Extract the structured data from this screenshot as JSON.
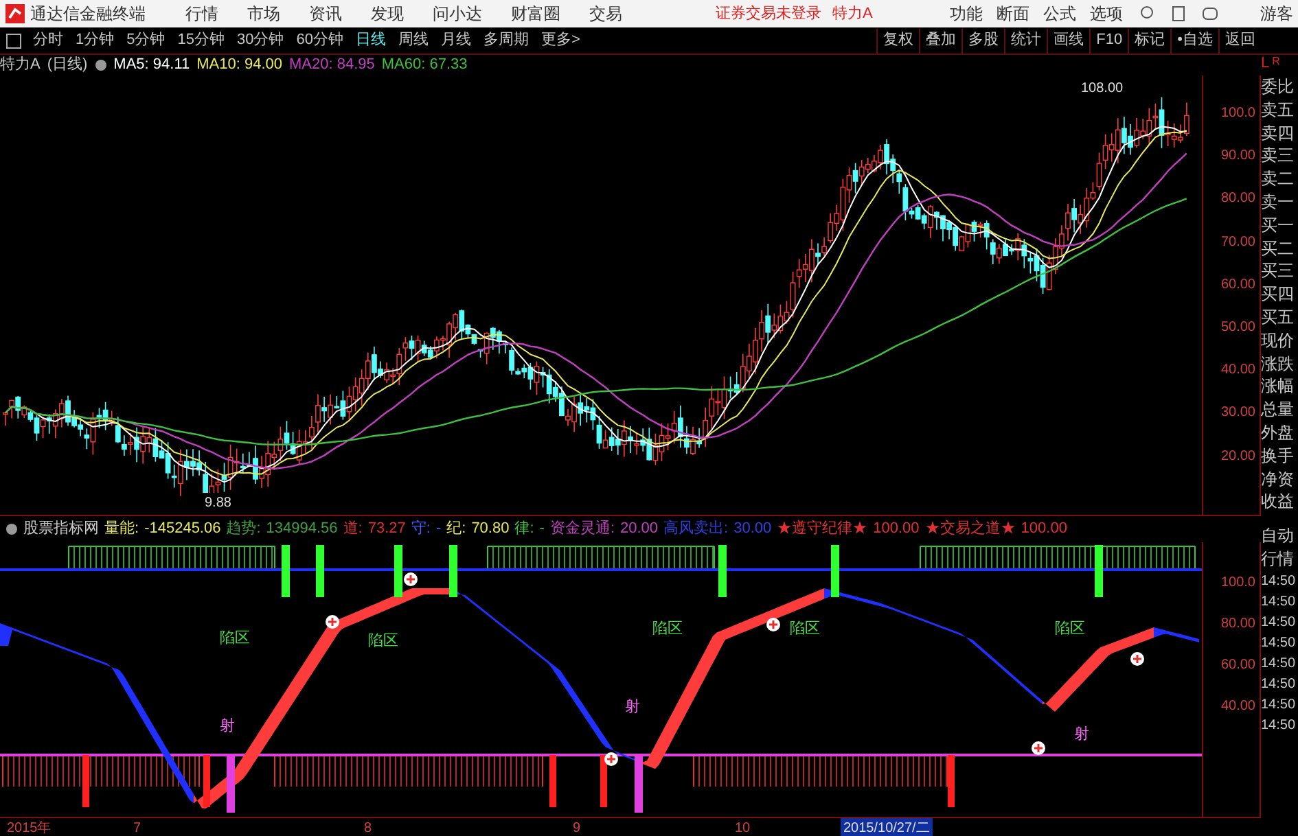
{
  "title_bar": {
    "app_name": "通达信金融终端",
    "menu": [
      "行情",
      "市场",
      "资讯",
      "发现",
      "问小达",
      "财富圈",
      "交易"
    ],
    "login_status": "证券交易未登录",
    "stock_name": "特力A",
    "actions": [
      "功能",
      "断面",
      "公式",
      "选项"
    ],
    "user": "游客"
  },
  "toolbar": {
    "periods": [
      {
        "label": "分时",
        "selected": false
      },
      {
        "label": "1分钟",
        "selected": false
      },
      {
        "label": "5分钟",
        "selected": false
      },
      {
        "label": "15分钟",
        "selected": false
      },
      {
        "label": "30分钟",
        "selected": false
      },
      {
        "label": "60分钟",
        "selected": false
      },
      {
        "label": "日线",
        "selected": true
      },
      {
        "label": "周线",
        "selected": false
      },
      {
        "label": "月线",
        "selected": false
      },
      {
        "label": "多周期",
        "selected": false
      },
      {
        "label": "更多>",
        "selected": false
      }
    ],
    "buttons": [
      "复权",
      "叠加",
      "多股",
      "统计",
      "画线",
      "F10",
      "标记",
      "•自选",
      "返回"
    ]
  },
  "price_chart": {
    "title": "特力A",
    "period": "(日线)",
    "ma": [
      {
        "label": "MA5: 94.11",
        "color": "#ffffff"
      },
      {
        "label": "MA10: 94.00",
        "color": "#e8e85a"
      },
      {
        "label": "MA20: 84.95",
        "color": "#c040c0"
      },
      {
        "label": "MA60: 67.33",
        "color": "#40c040"
      }
    ],
    "high_label": "108.00",
    "low_label": "9.88",
    "yticks": [
      "100.0",
      "90.00",
      "80.00",
      "70.00",
      "60.00",
      "50.00",
      "40.00",
      "30.00",
      "20.00"
    ]
  },
  "indicator": {
    "name": "股票指标网",
    "items": [
      {
        "label": "量能:",
        "value": "-145245.06",
        "color": "#e8e85a"
      },
      {
        "label": "趋势:",
        "value": "134994.56",
        "color": "#40a040"
      },
      {
        "label": "道:",
        "value": "73.27",
        "color": "#e03030"
      },
      {
        "label": "守:",
        "value": "-",
        "color": "#4060ff"
      },
      {
        "label": "纪:",
        "value": "70.80",
        "color": "#e8e85a"
      },
      {
        "label": "律:",
        "value": "-",
        "color": "#40c040"
      },
      {
        "label": "资金灵通:",
        "value": "20.00",
        "color": "#c040c0"
      },
      {
        "label": "高风卖出:",
        "value": "30.00",
        "color": "#3040e0"
      },
      {
        "label": "★遵守纪律★",
        "value": "100.00",
        "color": "#e03030"
      },
      {
        "label": "★交易之道★",
        "value": "100.00",
        "color": "#e03030"
      }
    ],
    "yticks": [
      "100.0",
      "80.00",
      "60.00",
      "40.00"
    ],
    "zone_labels": [
      {
        "text": "陷区",
        "kind": "zone"
      },
      {
        "text": "陷区",
        "kind": "zone"
      },
      {
        "text": "陷区",
        "kind": "zone"
      },
      {
        "text": "陷区",
        "kind": "zone"
      },
      {
        "text": "陷区",
        "kind": "zone"
      },
      {
        "text": "射",
        "kind": "shot"
      },
      {
        "text": "射",
        "kind": "shot"
      },
      {
        "text": "射",
        "kind": "shot"
      }
    ]
  },
  "x_axis": [
    {
      "label": "2015年",
      "selected": false
    },
    {
      "label": "7",
      "selected": false
    },
    {
      "label": "8",
      "selected": false
    },
    {
      "label": "9",
      "selected": false
    },
    {
      "label": "10",
      "selected": false
    },
    {
      "label": "2015/10/27/二",
      "selected": true
    }
  ],
  "side_panel": {
    "corner_left": "L",
    "corner_right": "R",
    "labels": [
      "委比",
      "卖五",
      "卖四",
      "卖三",
      "卖二",
      "卖一",
      "买一",
      "买二",
      "买三",
      "买四",
      "买五",
      "现价",
      "涨跌",
      "涨幅",
      "总量",
      "外盘",
      "换手",
      "净资",
      "收益"
    ],
    "lower_labels": [
      "自动",
      "行情"
    ],
    "times": [
      "14:50",
      "14:50",
      "14:50",
      "14:50",
      "14:50",
      "14:50",
      "14:50",
      "14:50"
    ]
  }
}
